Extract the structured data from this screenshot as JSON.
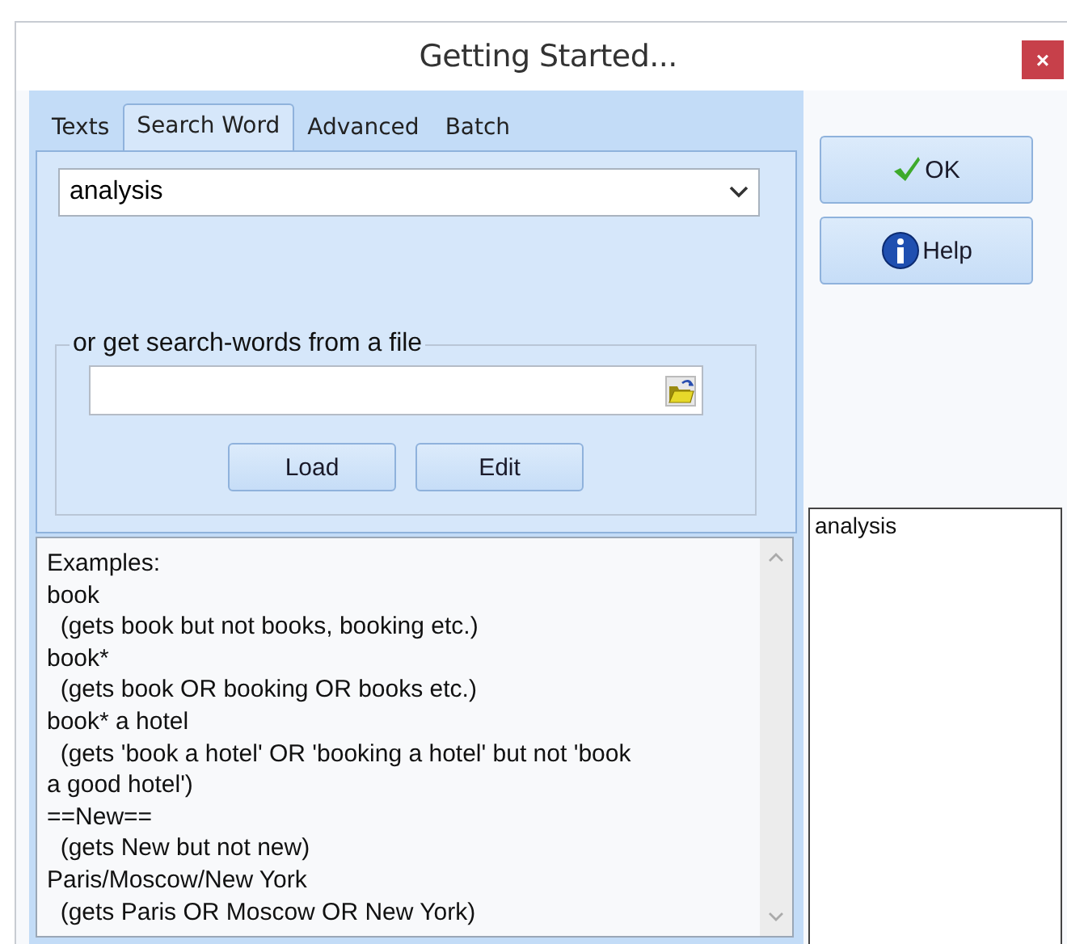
{
  "window": {
    "title": "Getting Started...",
    "close": "×"
  },
  "tabs": [
    {
      "label": "Texts",
      "selected": false
    },
    {
      "label": "Search Word",
      "selected": true
    },
    {
      "label": "Advanced",
      "selected": false
    },
    {
      "label": "Batch",
      "selected": false
    }
  ],
  "search_word": {
    "value": "analysis"
  },
  "file_group": {
    "legend": "or get search-words from a file",
    "buttons": [
      "Load",
      "Edit"
    ]
  },
  "examples": [
    "Examples:",
    "book",
    "  (gets book but not books, booking etc.)",
    "book*",
    "  (gets book OR booking OR books etc.)",
    "book* a hotel",
    "  (gets 'book a hotel' OR 'booking a hotel' but not 'book",
    "a good hotel')",
    "==New==",
    "  (gets New but not new)",
    "Paris/Moscow/New York",
    "  (gets Paris OR Moscow OR New York)"
  ],
  "side_buttons": [
    {
      "kind": "ok",
      "label": "OK"
    },
    {
      "kind": "help",
      "label": "Help"
    }
  ],
  "word_list": [
    "analysis"
  ]
}
